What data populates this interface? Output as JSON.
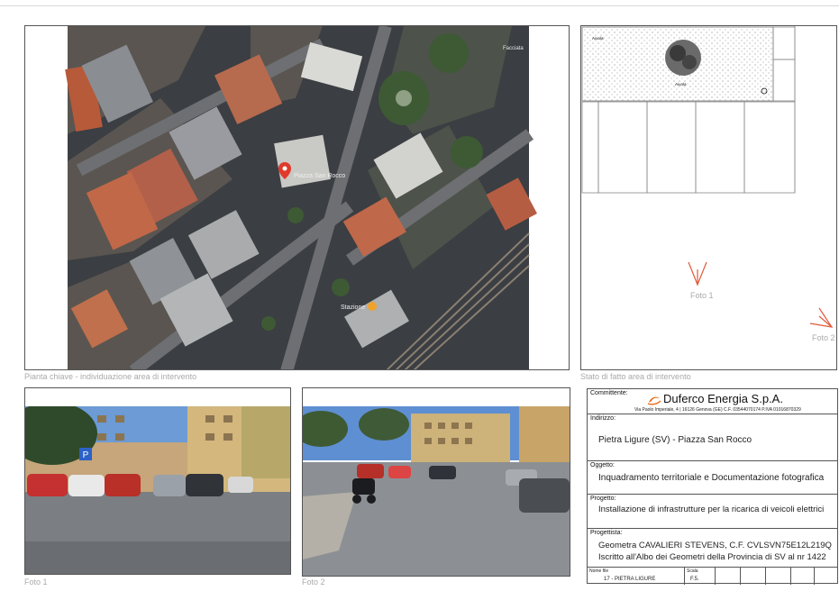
{
  "map": {
    "pin_label": "Piazza San Rocco",
    "station_label": "Stazione",
    "poi_label": "Facciata",
    "caption": "Pianta chiave - individuazione area di intervento"
  },
  "plan": {
    "aiuola_1": "Aiuola",
    "aiuola_2": "Aiuola",
    "foto1_label": "Foto 1",
    "foto2_label": "Foto 2",
    "caption": "Stato di fatto area di intervento"
  },
  "photos": {
    "foto1_caption": "Foto 1",
    "foto2_caption": "Foto 2"
  },
  "titleblock": {
    "committente_label": "Committente:",
    "company": "Duferco Energia S.p.A.",
    "company_address": "Via Paolo Imperiale, 4 | 16126 Genova (GE)   C.F. 03544070174   P.IVA 01016870329",
    "indirizzo_label": "Indirizzo:",
    "indirizzo": "Pietra Ligure (SV) - Piazza San Rocco",
    "oggetto_label": "Oggetto:",
    "oggetto": "Inquadramento territoriale e Documentazione fotografica",
    "progetto_label": "Progetto:",
    "progetto": "Installazione di infrastrutture per la ricarica di veicoli elettrici",
    "progettista_label": "Progettista:",
    "progettista_1": "Geometra CAVALIERI STEVENS, C.F. CVLSVN75E12L219Q",
    "progettista_2": "Iscritto all'Albo dei Geometri della Provincia di SV al nr 1422",
    "nome_file_label": "Nome file",
    "nome_file": "17 - PIETRA LIGURE",
    "scala_label": "Scala",
    "scala": "F.5."
  },
  "colors": {
    "brand": "#e8650a",
    "frame": "#555555",
    "caption": "#aaaaaa",
    "arrow": "#e05a3a"
  }
}
